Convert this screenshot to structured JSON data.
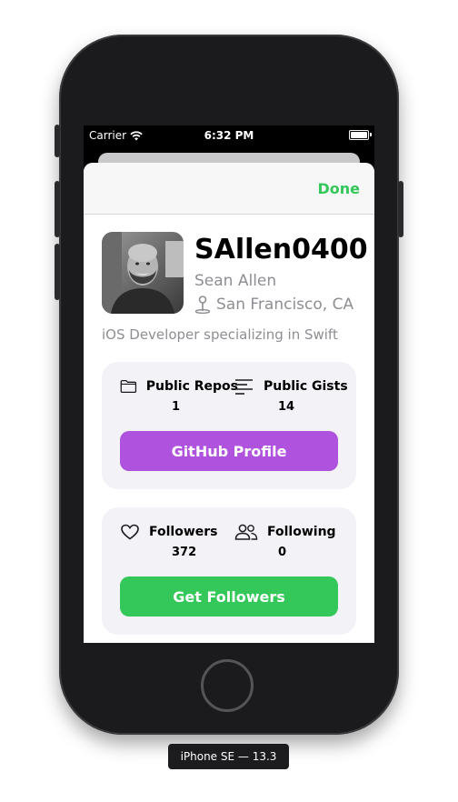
{
  "device": {
    "label": "iPhone SE — 13.3"
  },
  "status_bar": {
    "carrier": "Carrier",
    "time": "6:32 PM"
  },
  "nav": {
    "done_label": "Done"
  },
  "profile": {
    "username": "SAllen0400",
    "full_name": "Sean Allen",
    "location": "San Francisco, CA",
    "bio": "iOS Developer specializing in Swift"
  },
  "repo_card": {
    "public_repos_label": "Public Repos",
    "public_repos_count": "1",
    "public_gists_label": "Public Gists",
    "public_gists_count": "14",
    "button_label": "GitHub Profile"
  },
  "follower_card": {
    "followers_label": "Followers",
    "followers_count": "372",
    "following_label": "Following",
    "following_count": "0",
    "button_label": "Get Followers"
  },
  "colors": {
    "accent_green": "#34c759",
    "accent_purple": "#af52de",
    "card_bg": "#f2f2f7",
    "secondary_text": "#8e8e93"
  }
}
